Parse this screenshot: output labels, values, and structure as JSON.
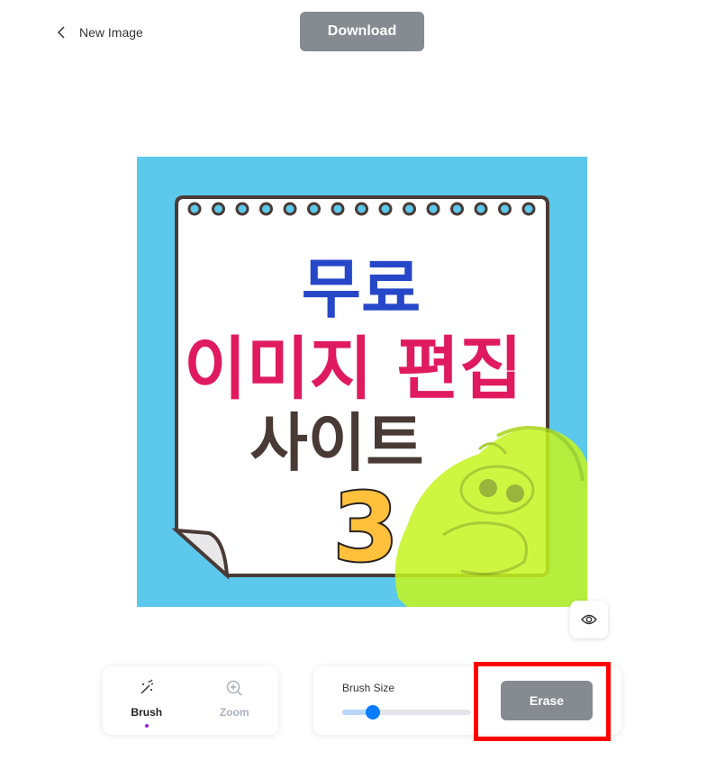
{
  "header": {
    "back_label": "New Image",
    "download_label": "Download"
  },
  "image": {
    "title_line1": "무료",
    "title_line2": "이미지 편집",
    "title_line3": "사이트",
    "number": "3",
    "background_color": "#5bc8ec",
    "line1_color": "#2747c9",
    "line2_color": "#e01a5f",
    "line3_color": "#4a3a35",
    "brush_overlay_color": "#c6f51f"
  },
  "tools": {
    "brush_label": "Brush",
    "zoom_label": "Zoom",
    "active_tool": "Brush"
  },
  "brush": {
    "size_label": "Brush Size",
    "size_fraction": 0.24,
    "erase_label": "Erase"
  },
  "colors": {
    "button_gray": "#868b91",
    "accent_blue": "#0a7cff",
    "active_dot": "#9b1fd6",
    "highlight": "#ff0000"
  }
}
